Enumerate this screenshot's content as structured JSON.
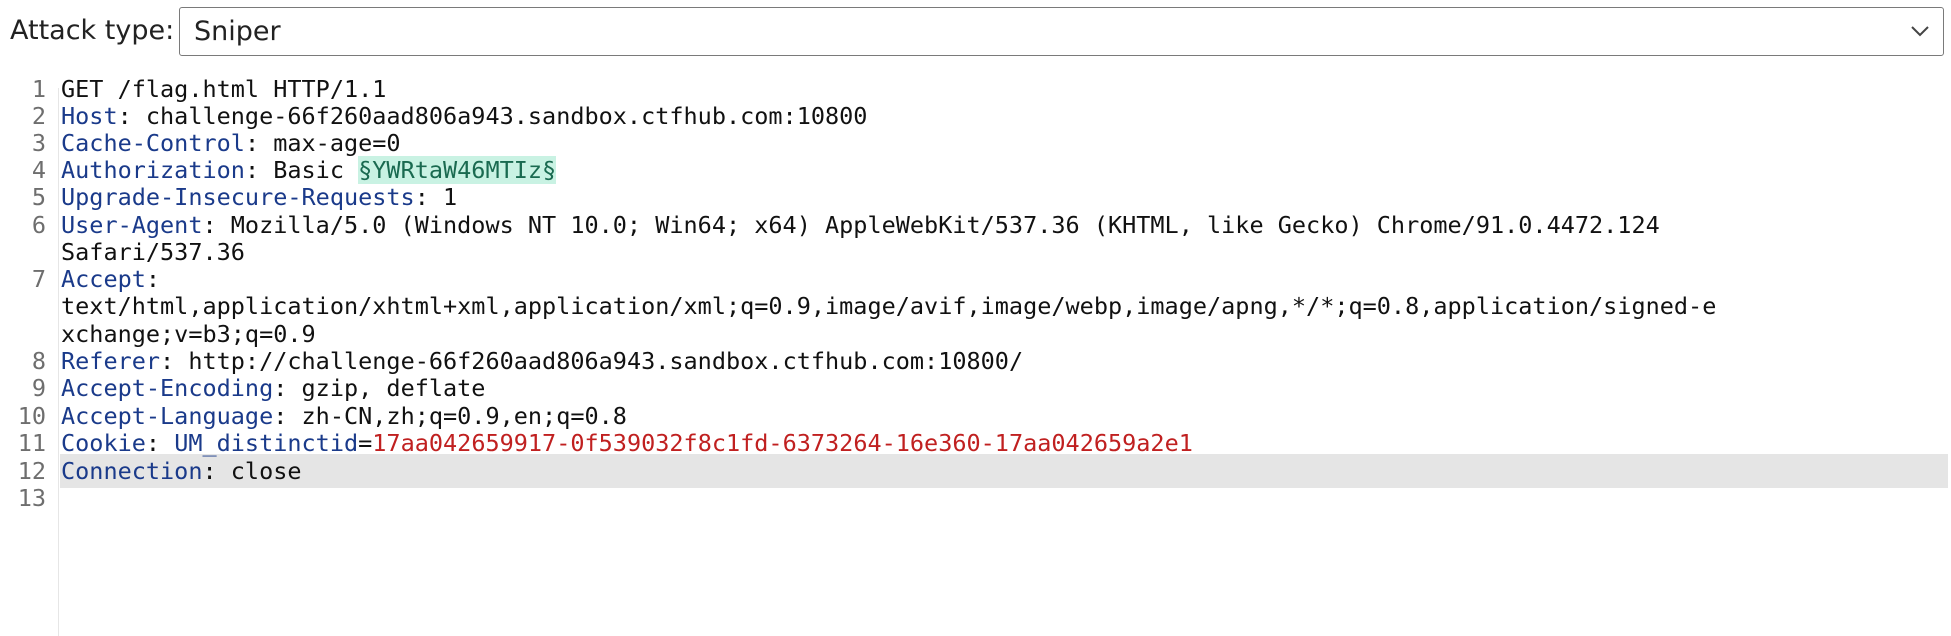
{
  "attack": {
    "label": "Attack type:",
    "selected": "Sniper"
  },
  "request": {
    "lines": [
      {
        "num": "1",
        "text": "GET /flag.html HTTP/1.1"
      },
      {
        "num": "2",
        "name": "Host",
        "value": "challenge-66f260aad806a943.sandbox.ctfhub.com:10800"
      },
      {
        "num": "3",
        "name": "Cache-Control",
        "value": "max-age=0"
      },
      {
        "num": "4",
        "name": "Authorization",
        "value": "Basic ",
        "payload": "§YWRtaW46MTIz§"
      },
      {
        "num": "5",
        "name": "Upgrade-Insecure-Requests",
        "value": "1"
      },
      {
        "num": "6",
        "name": "User-Agent",
        "value": "Mozilla/5.0 (Windows NT 10.0; Win64; x64) AppleWebKit/537.36 (KHTML, like Gecko) Chrome/91.0.4472.124",
        "cont": "Safari/537.36"
      },
      {
        "num": "7",
        "name": "Accept",
        "value": "",
        "cont": "text/html,application/xhtml+xml,application/xml;q=0.9,image/avif,image/webp,image/apng,*/*;q=0.8,application/signed-e",
        "cont2": "xchange;v=b3;q=0.9"
      },
      {
        "num": "8",
        "name": "Referer",
        "value": "http://challenge-66f260aad806a943.sandbox.ctfhub.com:10800/"
      },
      {
        "num": "9",
        "name": "Accept-Encoding",
        "value": "gzip, deflate"
      },
      {
        "num": "10",
        "name": "Accept-Language",
        "value": "zh-CN,zh;q=0.9,en;q=0.8"
      },
      {
        "num": "11",
        "name": "Cookie",
        "cookie_name": "UM_distinctid",
        "cookie_value": "17aa042659917-0f539032f8c1fd-6373264-16e360-17aa042659a2e1"
      },
      {
        "num": "12",
        "name": "Connection",
        "value": "close"
      },
      {
        "num": "13",
        "text": ""
      }
    ],
    "colon": ": "
  },
  "colors": {
    "header_name": "#1a3a8a",
    "cookie_value": "#c02020",
    "payload_bg": "#c9f2e3",
    "selected_line": "#e5e5e5"
  }
}
